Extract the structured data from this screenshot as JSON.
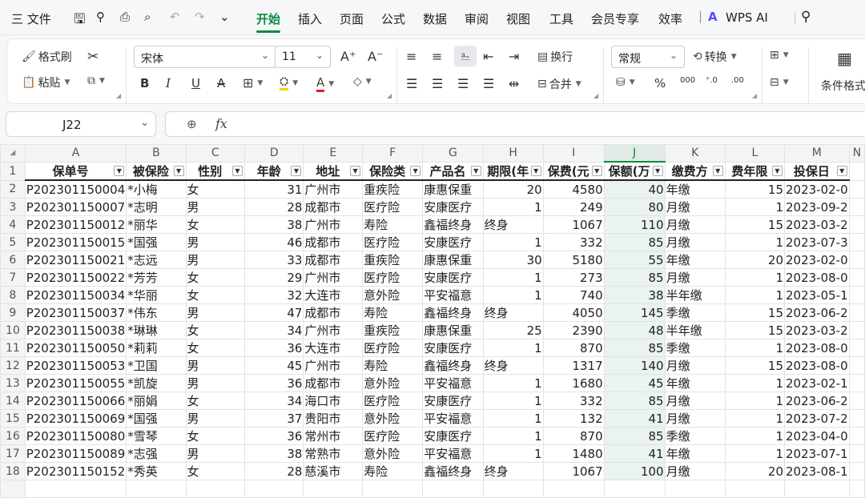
{
  "menubar": {
    "file_label": "三 文件",
    "tabs": [
      "开始",
      "插入",
      "页面",
      "公式",
      "数据",
      "审阅",
      "视图",
      "工具",
      "会员专享",
      "效率"
    ],
    "active_tab": "开始",
    "ai_label": "WPS AI"
  },
  "ribbon": {
    "format_painter": "格式刷",
    "paste": "粘贴",
    "font_name": "宋体",
    "font_size": "11",
    "wrap": "换行",
    "merge": "合并",
    "number_format": "常规",
    "convert": "转换",
    "conditional": "条件格式",
    "bold": "B",
    "italic": "I",
    "underline": "U",
    "strike": "A",
    "percent": "%"
  },
  "formula_bar": {
    "cell_ref": "J22",
    "fx": "fx",
    "formula": ""
  },
  "sheet": {
    "columns": [
      "A",
      "B",
      "C",
      "D",
      "E",
      "F",
      "G",
      "H",
      "I",
      "J",
      "K",
      "L",
      "M",
      "N"
    ],
    "selected_column": "J",
    "headers": [
      "保单号",
      "被保险",
      "性别",
      "年龄",
      "地址",
      "保险类",
      "产品名",
      "期限(年",
      "保费(元",
      "保额(万",
      "缴费方",
      "费年限",
      "投保日",
      ""
    ],
    "rows": [
      [
        "P202301150004",
        "*小梅",
        "女",
        "31",
        "广州市",
        "重疾险",
        "康惠保重",
        "20",
        "4580",
        "40",
        "年缴",
        "15",
        "2023-02-0",
        ""
      ],
      [
        "P202301150007",
        "*志明",
        "男",
        "28",
        "成都市",
        "医疗险",
        "安康医疗",
        "1",
        "249",
        "80",
        "月缴",
        "1",
        "2023-09-2",
        ""
      ],
      [
        "P202301150012",
        "*丽华",
        "女",
        "38",
        "广州市",
        "寿险",
        "鑫福终身",
        "终身",
        "1067",
        "110",
        "月缴",
        "15",
        "2023-03-2",
        ""
      ],
      [
        "P202301150015",
        "*国强",
        "男",
        "46",
        "成都市",
        "医疗险",
        "安康医疗",
        "1",
        "332",
        "85",
        "月缴",
        "1",
        "2023-07-3",
        ""
      ],
      [
        "P202301150021",
        "*志远",
        "男",
        "33",
        "成都市",
        "重疾险",
        "康惠保重",
        "30",
        "5180",
        "55",
        "年缴",
        "20",
        "2023-02-0",
        ""
      ],
      [
        "P202301150022",
        "*芳芳",
        "女",
        "29",
        "广州市",
        "医疗险",
        "安康医疗",
        "1",
        "273",
        "85",
        "月缴",
        "1",
        "2023-08-0",
        ""
      ],
      [
        "P202301150034",
        "*华丽",
        "女",
        "32",
        "大连市",
        "意外险",
        "平安福意",
        "1",
        "740",
        "38",
        "半年缴",
        "1",
        "2023-05-1",
        ""
      ],
      [
        "P202301150037",
        "*伟东",
        "男",
        "47",
        "成都市",
        "寿险",
        "鑫福终身",
        "终身",
        "4050",
        "145",
        "季缴",
        "15",
        "2023-06-2",
        ""
      ],
      [
        "P202301150038",
        "*琳琳",
        "女",
        "34",
        "广州市",
        "重疾险",
        "康惠保重",
        "25",
        "2390",
        "48",
        "半年缴",
        "15",
        "2023-03-2",
        ""
      ],
      [
        "P202301150050",
        "*莉莉",
        "女",
        "36",
        "大连市",
        "医疗险",
        "安康医疗",
        "1",
        "870",
        "85",
        "季缴",
        "1",
        "2023-08-0",
        ""
      ],
      [
        "P202301150053",
        "*卫国",
        "男",
        "45",
        "广州市",
        "寿险",
        "鑫福终身",
        "终身",
        "1317",
        "140",
        "月缴",
        "15",
        "2023-08-0",
        ""
      ],
      [
        "P202301150055",
        "*凯旋",
        "男",
        "36",
        "成都市",
        "意外险",
        "平安福意",
        "1",
        "1680",
        "45",
        "年缴",
        "1",
        "2023-02-1",
        ""
      ],
      [
        "P202301150066",
        "*丽娟",
        "女",
        "34",
        "海口市",
        "医疗险",
        "安康医疗",
        "1",
        "332",
        "85",
        "月缴",
        "1",
        "2023-06-2",
        ""
      ],
      [
        "P202301150069",
        "*国强",
        "男",
        "37",
        "贵阳市",
        "意外险",
        "平安福意",
        "1",
        "132",
        "41",
        "月缴",
        "1",
        "2023-07-2",
        ""
      ],
      [
        "P202301150080",
        "*雪琴",
        "女",
        "36",
        "常州市",
        "医疗险",
        "安康医疗",
        "1",
        "870",
        "85",
        "季缴",
        "1",
        "2023-04-0",
        ""
      ],
      [
        "P202301150089",
        "*志强",
        "男",
        "38",
        "常熟市",
        "意外险",
        "平安福意",
        "1",
        "1480",
        "41",
        "年缴",
        "1",
        "2023-07-1",
        ""
      ],
      [
        "P202301150152",
        "*秀英",
        "女",
        "28",
        "慈溪市",
        "寿险",
        "鑫福终身",
        "终身",
        "1067",
        "100",
        "月缴",
        "20",
        "2023-08-1",
        ""
      ]
    ]
  },
  "colors": {
    "accent": "#0b8a3d",
    "header_bg": "#f3f4f6"
  }
}
